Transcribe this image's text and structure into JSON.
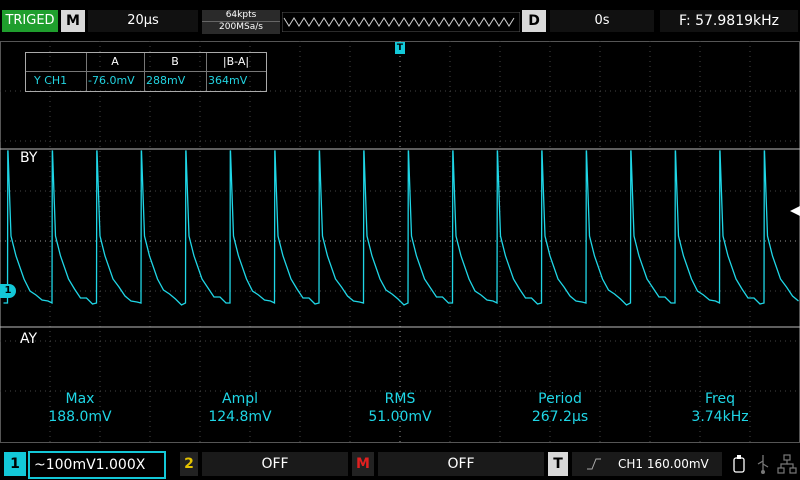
{
  "topbar": {
    "status": "TRIGED",
    "mode_button": "M",
    "timebase": "20μs",
    "memory_depth": "64kpts",
    "sample_rate": "200MSa/s",
    "delay_button": "D",
    "delay_value": "0s",
    "frequency": "F: 57.9819kHz"
  },
  "markers": {
    "trigger_pos": "T",
    "channel": "1"
  },
  "cursor_table": {
    "col_a": "A",
    "col_b": "B",
    "col_diff": "|B-A|",
    "row_label": "Y CH1",
    "a_value": "-76.0mV",
    "b_value": "288mV",
    "diff_value": "364mV"
  },
  "cursors": {
    "b_label": "BY",
    "a_label": "AY"
  },
  "measurements": [
    {
      "name": "Max",
      "value": "188.0mV"
    },
    {
      "name": "Ampl",
      "value": "124.8mV"
    },
    {
      "name": "RMS",
      "value": "51.00mV"
    },
    {
      "name": "Period",
      "value": "267.2μs"
    },
    {
      "name": "Freq",
      "value": "3.74kHz"
    }
  ],
  "bottombar": {
    "ch1_num": "1",
    "ch1_setting": "~100mV1.000X",
    "ch2_num": "2",
    "ch2_state": "OFF",
    "math_num": "M",
    "math_state": "OFF",
    "trigger_num": "T",
    "trigger_info": "CH1 160.00mV"
  },
  "colors": {
    "trace": "#1fd6e6",
    "triged": "#1f9e2d"
  }
}
